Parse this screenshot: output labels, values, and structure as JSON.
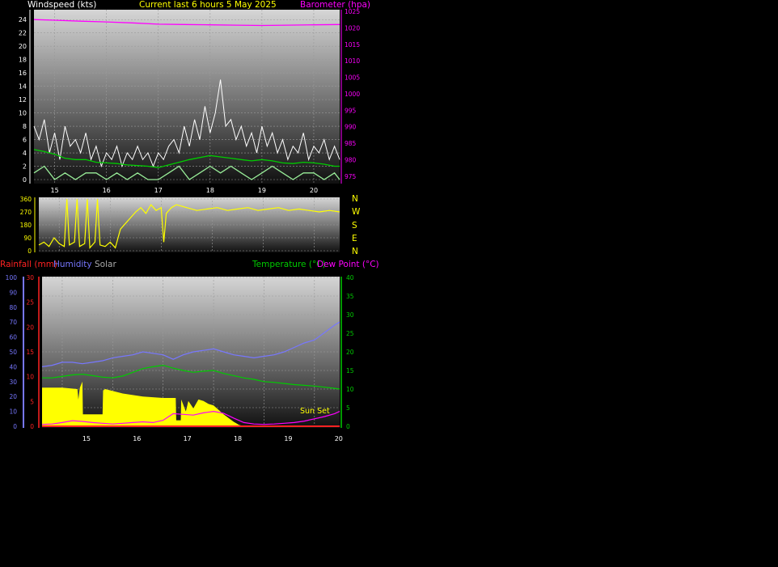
{
  "header": {
    "left_title": "Windspeed (kts)",
    "center_title": "Current last 6 hours 5 May 2025",
    "right_title": "Barometer (hpa)"
  },
  "colors": {
    "white": "#ffffff",
    "yellow": "#ffff00",
    "magenta": "#ff00ff",
    "green": "#00cc00",
    "light_green": "#99ee99",
    "blue": "#7777ff",
    "red": "#ff2222",
    "grey": "#aaaaaa"
  },
  "compass_labels": [
    "N",
    "W",
    "S",
    "E",
    "N"
  ],
  "lower_legend": {
    "rainfall": "Rainfall (mm)",
    "humidity": "Humidity",
    "solar": "Solar",
    "temperature": "Temperature (°C)",
    "dew_point": "Dew Point (°C)"
  },
  "annotation": {
    "sunset": "Sun Set"
  },
  "chart_data": [
    {
      "type": "line",
      "chart": "wind_barometer",
      "title": "Current last 6 hours 5 May 2025",
      "ylabel": "Windspeed (kts)",
      "y2label": "Barometer (hpa)",
      "xlim": [
        14.6,
        20.5
      ],
      "x_ticks": [
        15,
        16,
        17,
        18,
        19,
        20
      ],
      "ylim": [
        0,
        25
      ],
      "y_ticks": [
        0,
        2,
        4,
        6,
        8,
        10,
        12,
        14,
        16,
        18,
        20,
        22,
        24
      ],
      "y2lim": [
        974,
        1025
      ],
      "y2_ticks": [
        975,
        980,
        985,
        990,
        995,
        1000,
        1005,
        1010,
        1015,
        1020,
        1025
      ],
      "grid": true,
      "series": [
        {
          "axis": "y2",
          "color": "magenta",
          "x": [
            14.6,
            15.0,
            15.5,
            16.0,
            16.5,
            17.0,
            17.5,
            18.0,
            18.5,
            19.0,
            19.5,
            20.0,
            20.5
          ],
          "values": [
            1022.5,
            1022.3,
            1022.0,
            1021.8,
            1021.5,
            1021.1,
            1021.0,
            1020.9,
            1020.8,
            1020.7,
            1020.8,
            1020.9,
            1021.0
          ]
        },
        {
          "axis": "y",
          "color": "white",
          "x": [
            14.6,
            14.7,
            14.8,
            14.9,
            15.0,
            15.1,
            15.2,
            15.3,
            15.4,
            15.5,
            15.6,
            15.7,
            15.8,
            15.9,
            16.0,
            16.1,
            16.2,
            16.3,
            16.4,
            16.5,
            16.6,
            16.7,
            16.8,
            16.9,
            17.0,
            17.1,
            17.2,
            17.3,
            17.4,
            17.5,
            17.6,
            17.7,
            17.8,
            17.9,
            18.0,
            18.1,
            18.2,
            18.3,
            18.4,
            18.5,
            18.6,
            18.7,
            18.8,
            18.9,
            19.0,
            19.1,
            19.2,
            19.3,
            19.4,
            19.5,
            19.6,
            19.7,
            19.8,
            19.9,
            20.0,
            20.1,
            20.2,
            20.3,
            20.4,
            20.5
          ],
          "values": [
            8,
            6,
            9,
            4,
            7,
            3,
            8,
            5,
            6,
            4,
            7,
            3,
            5,
            2,
            4,
            3,
            5,
            2,
            4,
            3,
            5,
            3,
            4,
            2,
            4,
            3,
            5,
            6,
            4,
            8,
            5,
            9,
            6,
            11,
            7,
            10,
            15,
            8,
            9,
            6,
            8,
            5,
            7,
            4,
            8,
            5,
            7,
            4,
            6,
            3,
            5,
            4,
            7,
            3,
            5,
            4,
            6,
            3,
            5,
            3
          ]
        },
        {
          "axis": "y",
          "color": "green",
          "x": [
            14.6,
            14.8,
            15.0,
            15.2,
            15.4,
            15.6,
            15.8,
            16.0,
            16.2,
            16.4,
            16.6,
            16.8,
            17.0,
            17.2,
            17.4,
            17.6,
            17.8,
            18.0,
            18.2,
            18.4,
            18.6,
            18.8,
            19.0,
            19.2,
            19.4,
            19.6,
            19.8,
            20.0,
            20.2,
            20.4,
            20.5
          ],
          "values": [
            4.5,
            4.2,
            3.8,
            3.2,
            3.0,
            3.0,
            2.6,
            2.5,
            2.4,
            2.2,
            2.1,
            2.0,
            1.8,
            2.2,
            2.6,
            3.0,
            3.3,
            3.6,
            3.4,
            3.2,
            3.0,
            2.8,
            3.0,
            2.8,
            2.5,
            2.4,
            2.6,
            2.5,
            2.3,
            2.0,
            2.0
          ]
        },
        {
          "axis": "y",
          "color": "light_green",
          "x": [
            14.6,
            14.8,
            15.0,
            15.2,
            15.4,
            15.6,
            15.8,
            16.0,
            16.2,
            16.4,
            16.6,
            16.8,
            17.0,
            17.2,
            17.4,
            17.6,
            17.8,
            18.0,
            18.2,
            18.4,
            18.6,
            18.8,
            19.0,
            19.2,
            19.4,
            19.6,
            19.8,
            20.0,
            20.2,
            20.4,
            20.5
          ],
          "values": [
            1,
            2,
            0,
            1,
            0,
            1,
            1,
            0,
            1,
            0,
            1,
            0,
            0,
            1,
            2,
            0,
            1,
            2,
            1,
            2,
            1,
            0,
            1,
            2,
            1,
            0,
            1,
            1,
            0,
            1,
            0
          ]
        }
      ]
    },
    {
      "type": "line",
      "chart": "wind_direction",
      "xlim": [
        14.6,
        20.5
      ],
      "ylim": [
        0,
        360
      ],
      "y_ticks": [
        0,
        90,
        180,
        270,
        360
      ],
      "grid": true,
      "series": [
        {
          "color": "yellow",
          "x": [
            14.6,
            14.7,
            14.8,
            14.9,
            15.0,
            15.1,
            15.15,
            15.2,
            15.3,
            15.35,
            15.4,
            15.5,
            15.55,
            15.6,
            15.7,
            15.75,
            15.8,
            15.9,
            16.0,
            16.1,
            16.2,
            16.3,
            16.4,
            16.5,
            16.6,
            16.7,
            16.8,
            16.9,
            17.0,
            17.05,
            17.1,
            17.2,
            17.3,
            17.5,
            17.7,
            17.9,
            18.1,
            18.3,
            18.5,
            18.7,
            18.9,
            19.1,
            19.3,
            19.5,
            19.7,
            19.9,
            20.1,
            20.3,
            20.5
          ],
          "values": [
            40,
            60,
            30,
            90,
            50,
            30,
            360,
            40,
            60,
            360,
            30,
            50,
            360,
            20,
            60,
            360,
            40,
            30,
            60,
            20,
            150,
            190,
            230,
            270,
            300,
            260,
            320,
            280,
            300,
            60,
            260,
            300,
            320,
            300,
            280,
            290,
            300,
            280,
            290,
            300,
            280,
            290,
            300,
            280,
            290,
            280,
            270,
            280,
            270
          ]
        }
      ]
    },
    {
      "type": "area",
      "chart": "rain_humidity_solar_temperature",
      "xlim": [
        14.6,
        20.5
      ],
      "x_ticks": [
        15,
        16,
        17,
        18,
        19,
        20
      ],
      "humidity_axis": {
        "ylim": [
          0,
          100
        ],
        "ticks": [
          0,
          10,
          20,
          30,
          40,
          50,
          60,
          70,
          80,
          90,
          100
        ]
      },
      "rainfall_axis": {
        "ylim": [
          0,
          30
        ],
        "ticks": [
          0,
          5,
          10,
          15,
          20,
          25,
          30
        ]
      },
      "temperature_axis": {
        "ylim": [
          0,
          40
        ],
        "ticks": [
          0,
          5,
          10,
          15,
          20,
          25,
          30,
          35,
          40
        ]
      },
      "grid": true,
      "series": [
        {
          "name": "Solar",
          "color": "yellow",
          "axis": "humidity",
          "style": "area",
          "x": [
            14.6,
            15.0,
            15.3,
            15.32,
            15.35,
            15.4,
            15.41,
            15.8,
            15.81,
            15.85,
            16.2,
            16.6,
            17.0,
            17.25,
            17.26,
            17.35,
            17.36,
            17.45,
            17.5,
            17.6,
            17.7,
            17.8,
            17.9,
            18.0,
            18.2,
            18.4,
            18.45,
            18.5,
            18.6
          ],
          "values": [
            26,
            26,
            25,
            18,
            26,
            30,
            8,
            8,
            24,
            25,
            22,
            20,
            19,
            19,
            4,
            4,
            18,
            10,
            17,
            12,
            18,
            17,
            15,
            14,
            8,
            3,
            2,
            1,
            0
          ]
        },
        {
          "name": "Humidity",
          "color": "blue",
          "axis": "humidity",
          "x": [
            14.6,
            14.8,
            15.0,
            15.2,
            15.4,
            15.6,
            15.8,
            16.0,
            16.2,
            16.4,
            16.6,
            16.8,
            17.0,
            17.2,
            17.4,
            17.6,
            17.8,
            18.0,
            18.2,
            18.4,
            18.6,
            18.8,
            19.0,
            19.2,
            19.4,
            19.6,
            19.8,
            20.0,
            20.2,
            20.4,
            20.5
          ],
          "values": [
            40,
            41,
            43,
            43,
            42,
            43,
            44,
            46,
            47,
            48,
            50,
            49,
            48,
            45,
            48,
            50,
            51,
            52,
            50,
            48,
            47,
            46,
            47,
            48,
            50,
            53,
            56,
            58,
            63,
            68,
            70
          ]
        },
        {
          "name": "Temperature (°C)",
          "color": "green",
          "axis": "temperature",
          "x": [
            14.6,
            14.8,
            15.0,
            15.2,
            15.4,
            15.6,
            15.8,
            16.0,
            16.2,
            16.4,
            16.6,
            16.8,
            17.0,
            17.2,
            17.4,
            17.6,
            17.8,
            18.0,
            18.2,
            18.4,
            18.6,
            18.8,
            19.0,
            19.2,
            19.4,
            19.6,
            19.8,
            20.0,
            20.2,
            20.4,
            20.5
          ],
          "values": [
            13,
            13,
            13.4,
            13.8,
            14,
            13.6,
            13.2,
            13,
            13.5,
            14.5,
            15.5,
            16,
            16.4,
            15.6,
            15,
            14.5,
            14.8,
            15,
            14.2,
            13.6,
            13,
            12.6,
            12,
            11.8,
            11.5,
            11.2,
            11,
            10.8,
            10.5,
            10.2,
            10
          ]
        },
        {
          "name": "Dew Point (°C)",
          "color": "magenta",
          "axis": "temperature",
          "x": [
            14.6,
            14.8,
            15.0,
            15.2,
            15.4,
            15.6,
            15.8,
            16.0,
            16.2,
            16.4,
            16.6,
            16.8,
            17.0,
            17.2,
            17.4,
            17.6,
            17.8,
            18.0,
            18.2,
            18.4,
            18.6,
            18.8,
            19.0,
            19.2,
            19.4,
            19.6,
            19.8,
            20.0,
            20.2,
            20.4,
            20.5
          ],
          "values": [
            0.5,
            0.6,
            1.0,
            1.5,
            1.3,
            1.0,
            0.8,
            0.6,
            0.8,
            1.0,
            1.2,
            1.0,
            1.6,
            3.4,
            3.2,
            3.0,
            3.6,
            4.0,
            3.5,
            2.2,
            1.0,
            0.6,
            0.5,
            0.6,
            0.8,
            1.0,
            1.4,
            2.0,
            2.6,
            3.4,
            4.0
          ]
        },
        {
          "name": "Rainfall (mm)",
          "color": "red",
          "axis": "rainfall",
          "x": [
            14.6,
            20.5
          ],
          "values": [
            0,
            0
          ]
        }
      ]
    }
  ]
}
